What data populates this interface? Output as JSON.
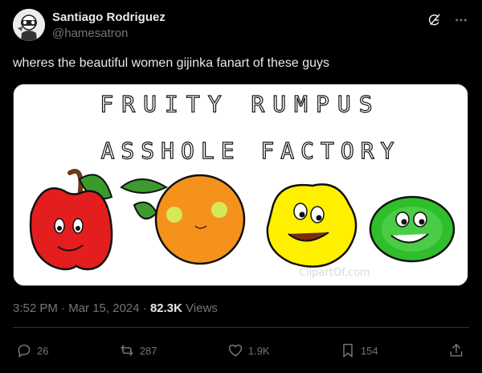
{
  "user": {
    "display_name": "Santiago Rodriguez",
    "handle": "@hamesatron",
    "avatar_icon": "avatar-photo"
  },
  "header_icons": [
    "grok-icon",
    "more-icon"
  ],
  "tweet": {
    "text": "wheres the beautiful women gijinka fanart of these guys"
  },
  "media": {
    "line1": "FRUITY RUMPUS",
    "line2": "ASSHOLE FACTORY",
    "watermark": "ClipartOf.com"
  },
  "meta": {
    "time": "3:52 PM",
    "separator1": "·",
    "date": "Mar 15, 2024",
    "separator2": "·",
    "views_count": "82.3K",
    "views_label": "Views"
  },
  "actions": {
    "replies": "26",
    "reposts": "287",
    "likes": "1.9K",
    "bookmarks": "154"
  },
  "colors": {
    "background": "#000000",
    "text_primary": "#e7e9ea",
    "text_secondary": "#71767b",
    "border": "#2f3336"
  }
}
